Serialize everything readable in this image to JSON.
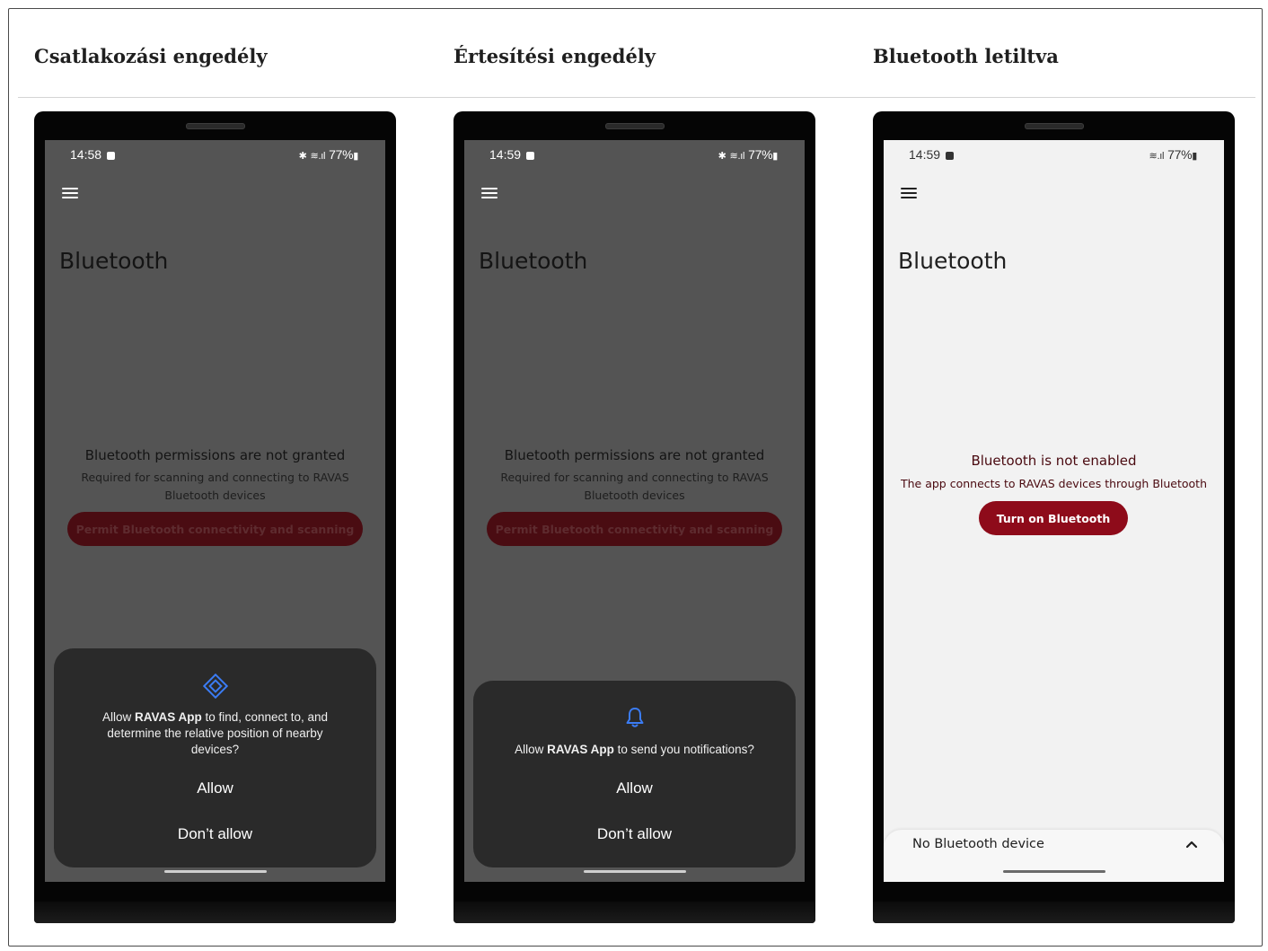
{
  "columns": [
    {
      "title": "Csatlakozási engedély",
      "status": {
        "time": "14:58",
        "right": "77%"
      },
      "screen_title": "Bluetooth",
      "message_title": "Bluetooth permissions are not granted",
      "message_sub": "Required for scanning and connecting to RAVAS Bluetooth devices",
      "button": "Permit Bluetooth connectivity and scanning",
      "dialog": {
        "icon": "nearby-devices-icon",
        "text_pre": "Allow ",
        "app_name": "RAVAS App",
        "text_post": " to find, connect to, and determine the relative position of nearby devices?",
        "allow": "Allow",
        "deny": "Don’t allow"
      }
    },
    {
      "title": "Értesítési engedély",
      "status": {
        "time": "14:59",
        "right": "77%"
      },
      "screen_title": "Bluetooth",
      "message_title": "Bluetooth permissions are not granted",
      "message_sub": "Required for scanning and connecting to RAVAS Bluetooth devices",
      "button": "Permit Bluetooth connectivity and scanning",
      "dialog": {
        "icon": "bell-icon",
        "text_pre": "Allow ",
        "app_name": "RAVAS App",
        "text_post": " to send you notifications?",
        "allow": "Allow",
        "deny": "Don’t allow"
      }
    },
    {
      "title": "Bluetooth letiltva",
      "status": {
        "time": "14:59",
        "right": "77%"
      },
      "screen_title": "Bluetooth",
      "message_title": "Bluetooth is not enabled",
      "message_sub": "The app connects to RAVAS devices through Bluetooth",
      "button": "Turn on Bluetooth",
      "bottom_sheet": {
        "label": "No Bluetooth device"
      }
    }
  ],
  "colors": {
    "dark_screen": "#545454",
    "light_screen": "#f2f2f2",
    "dialog_bg": "#2a2a2a",
    "accent_red": "#8e0b1a",
    "dim_red": "#4a0c12",
    "icon_blue": "#3b7cf4"
  }
}
